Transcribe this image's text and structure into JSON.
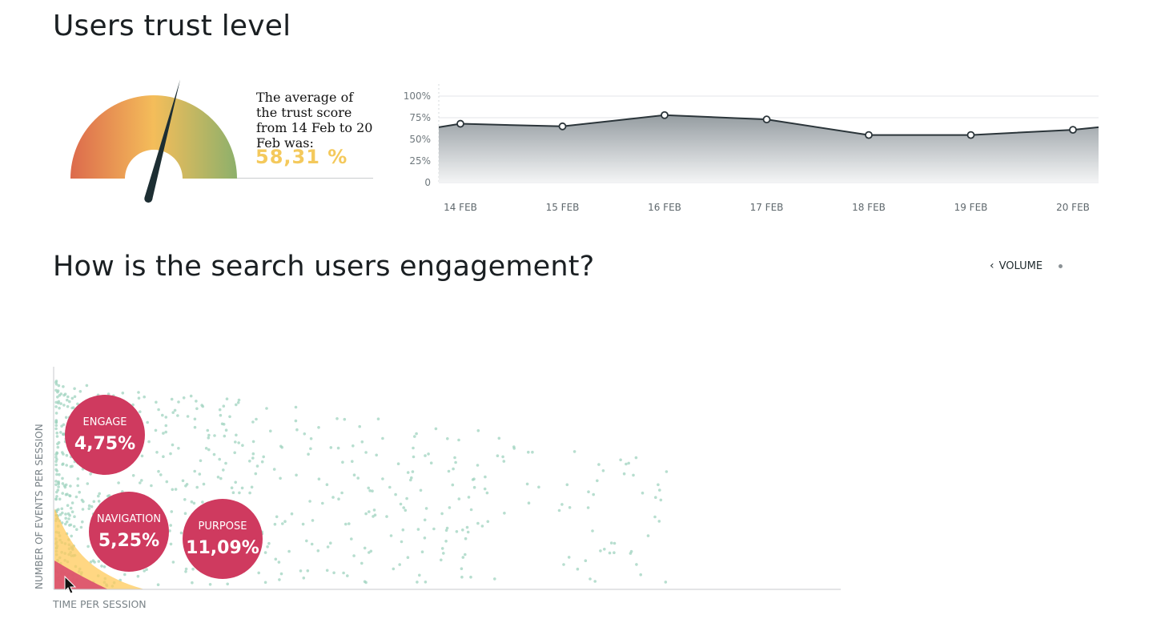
{
  "trust": {
    "title": "Users trust level",
    "avg_text": "The average of the trust score from 14 Feb to 20 Feb was:",
    "avg_value": "58,31 %",
    "gauge_value_percent": 58.31
  },
  "engagement": {
    "title": "How is the search users engagement?",
    "volume_label": "VOLUME",
    "y_axis_label": "NUMBER OF EVENTS PER SESSION",
    "x_axis_label": "TIME PER SESSION",
    "bubbles": [
      {
        "label": "ENGAGE",
        "value": "4,75%"
      },
      {
        "label": "NAVIGATION",
        "value": "5,25%"
      },
      {
        "label": "PURPOSE",
        "value": "11,09%"
      }
    ]
  },
  "colors": {
    "accent_yellow": "#f4c95c",
    "bubble_red": "#cf3a5f",
    "scatter_green": "#9fd3bf",
    "line_dark": "#2b353a"
  },
  "chart_data": {
    "type": "area",
    "title": "",
    "categories": [
      "14 FEB",
      "15 FEB",
      "16 FEB",
      "17 FEB",
      "18 FEB",
      "19 FEB",
      "20 FEB"
    ],
    "values": [
      68,
      65,
      78,
      73,
      55,
      55,
      61
    ],
    "y_ticks": [
      "100%",
      "75%",
      "50%",
      "25%",
      "0"
    ],
    "ylim": [
      0,
      100
    ],
    "grid": true
  }
}
